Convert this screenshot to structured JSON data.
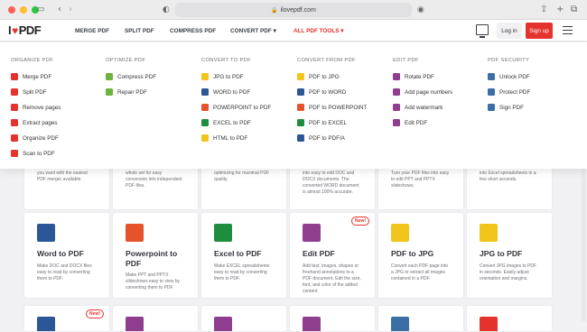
{
  "browser": {
    "url": "ilovepdf.com",
    "colors": {
      "close": "#fe5f57",
      "minimize": "#febc2e",
      "maximize": "#28c840"
    }
  },
  "header": {
    "logo_text_1": "I",
    "logo_text_2": "PDF",
    "nav": [
      "MERGE PDF",
      "SPLIT PDF",
      "COMPRESS PDF",
      "CONVERT PDF ▾",
      "ALL PDF TOOLS ▾"
    ],
    "login": "Log in",
    "signup": "Sign up",
    "accent": "#e5322d"
  },
  "menu": {
    "columns": [
      {
        "title": "ORGANIZE PDF",
        "items": [
          {
            "label": "Merge PDF",
            "icon": "merge-icon",
            "color": "#e5322d"
          },
          {
            "label": "Split PDF",
            "icon": "split-icon",
            "color": "#e5322d"
          },
          {
            "label": "Remove pages",
            "icon": "remove-pages-icon",
            "color": "#e5322d"
          },
          {
            "label": "Extract pages",
            "icon": "extract-pages-icon",
            "color": "#e5322d"
          },
          {
            "label": "Organize PDF",
            "icon": "organize-icon",
            "color": "#e5322d"
          },
          {
            "label": "Scan to PDF",
            "icon": "scan-icon",
            "color": "#e5322d"
          }
        ]
      },
      {
        "title": "OPTIMIZE PDF",
        "items": [
          {
            "label": "Compress PDF",
            "icon": "compress-icon",
            "color": "#6cb33e"
          },
          {
            "label": "Repair PDF",
            "icon": "repair-icon",
            "color": "#6cb33e"
          }
        ]
      },
      {
        "title": "CONVERT TO PDF",
        "items": [
          {
            "label": "JPG to PDF",
            "icon": "jpg-icon",
            "color": "#f2c51c"
          },
          {
            "label": "WORD to PDF",
            "icon": "word-icon",
            "color": "#2b5797"
          },
          {
            "label": "POWERPOINT to PDF",
            "icon": "powerpoint-icon",
            "color": "#e5532d"
          },
          {
            "label": "EXCEL to PDF",
            "icon": "excel-icon",
            "color": "#1e8e3e"
          },
          {
            "label": "HTML to PDF",
            "icon": "html-icon",
            "color": "#f2c51c"
          }
        ]
      },
      {
        "title": "CONVERT FROM PDF",
        "items": [
          {
            "label": "PDF to JPG",
            "icon": "pdf-jpg-icon",
            "color": "#f2c51c"
          },
          {
            "label": "PDF to WORD",
            "icon": "pdf-word-icon",
            "color": "#2b5797"
          },
          {
            "label": "PDF to POWERPOINT",
            "icon": "pdf-powerpoint-icon",
            "color": "#e5532d"
          },
          {
            "label": "PDF to EXCEL",
            "icon": "pdf-excel-icon",
            "color": "#1e8e3e"
          },
          {
            "label": "PDF to PDF/A",
            "icon": "pdfa-icon",
            "color": "#2b5797"
          }
        ]
      },
      {
        "title": "EDIT PDF",
        "items": [
          {
            "label": "Rotate PDF",
            "icon": "rotate-icon",
            "color": "#8e3d8f"
          },
          {
            "label": "Add page numbers",
            "icon": "page-numbers-icon",
            "color": "#8e3d8f"
          },
          {
            "label": "Add watermark",
            "icon": "watermark-icon",
            "color": "#8e3d8f"
          },
          {
            "label": "Edit PDF",
            "icon": "edit-icon",
            "color": "#8e3d8f"
          }
        ]
      },
      {
        "title": "PDF SECURITY",
        "items": [
          {
            "label": "Unlock PDF",
            "icon": "unlock-icon",
            "color": "#3a6ea5"
          },
          {
            "label": "Protect PDF",
            "icon": "protect-icon",
            "color": "#3a6ea5"
          },
          {
            "label": "Sign PDF",
            "icon": "sign-icon",
            "color": "#3a6ea5"
          }
        ]
      }
    ]
  },
  "cards_top": [
    {
      "desc": "you want with the easiest\nPDF merger available."
    },
    {
      "desc": "whole set for easy\nconversion into independent\nPDF files."
    },
    {
      "desc": "optimizing for maximal PDF\nquality."
    },
    {
      "desc": "into easy to edit DOC and\nDOCX documents. The\nconverted WORD document\nis almost 100% accurate."
    },
    {
      "desc": "Turn your PDF files into easy\nto edit PPT and PPTX\nslideshows."
    },
    {
      "desc": "into Excel spreadsheets in a\nfew short seconds."
    }
  ],
  "cards": [
    {
      "title": "Word to PDF",
      "desc": "Make DOC and DOCX files\neasy to read by converting\nthem to PDF.",
      "icon": "word-icon",
      "color": "#2b5797",
      "badge": ""
    },
    {
      "title": "Powerpoint to\nPDF",
      "desc": "Make PPT and PPTX\nslideshows easy to view by\nconverting them to PDF.",
      "icon": "powerpoint-icon",
      "color": "#e5532d",
      "badge": ""
    },
    {
      "title": "Excel to PDF",
      "desc": "Make EXCEL spreadsheets\neasy to read by converting\nthem to PDF.",
      "icon": "excel-icon",
      "color": "#1e8e3e",
      "badge": ""
    },
    {
      "title": "Edit PDF",
      "desc": "Add text, images, shapes or\nfreehand annotations to a\nPDF document. Edit the size,\nfont, and color of the added\ncontent.",
      "icon": "edit-icon",
      "color": "#8e3d8f",
      "badge": "New!"
    },
    {
      "title": "PDF to JPG",
      "desc": "Convert each PDF page into\na JPG or extract all images\ncontained in a PDF.",
      "icon": "pdf-jpg-icon",
      "color": "#f2c51c",
      "badge": ""
    },
    {
      "title": "JPG to PDF",
      "desc": "Convert JPG images to PDF\nin seconds. Easily adjust\norientation and margins.",
      "icon": "jpg-icon",
      "color": "#f2c51c",
      "badge": ""
    }
  ],
  "bottom_badge": "New!"
}
